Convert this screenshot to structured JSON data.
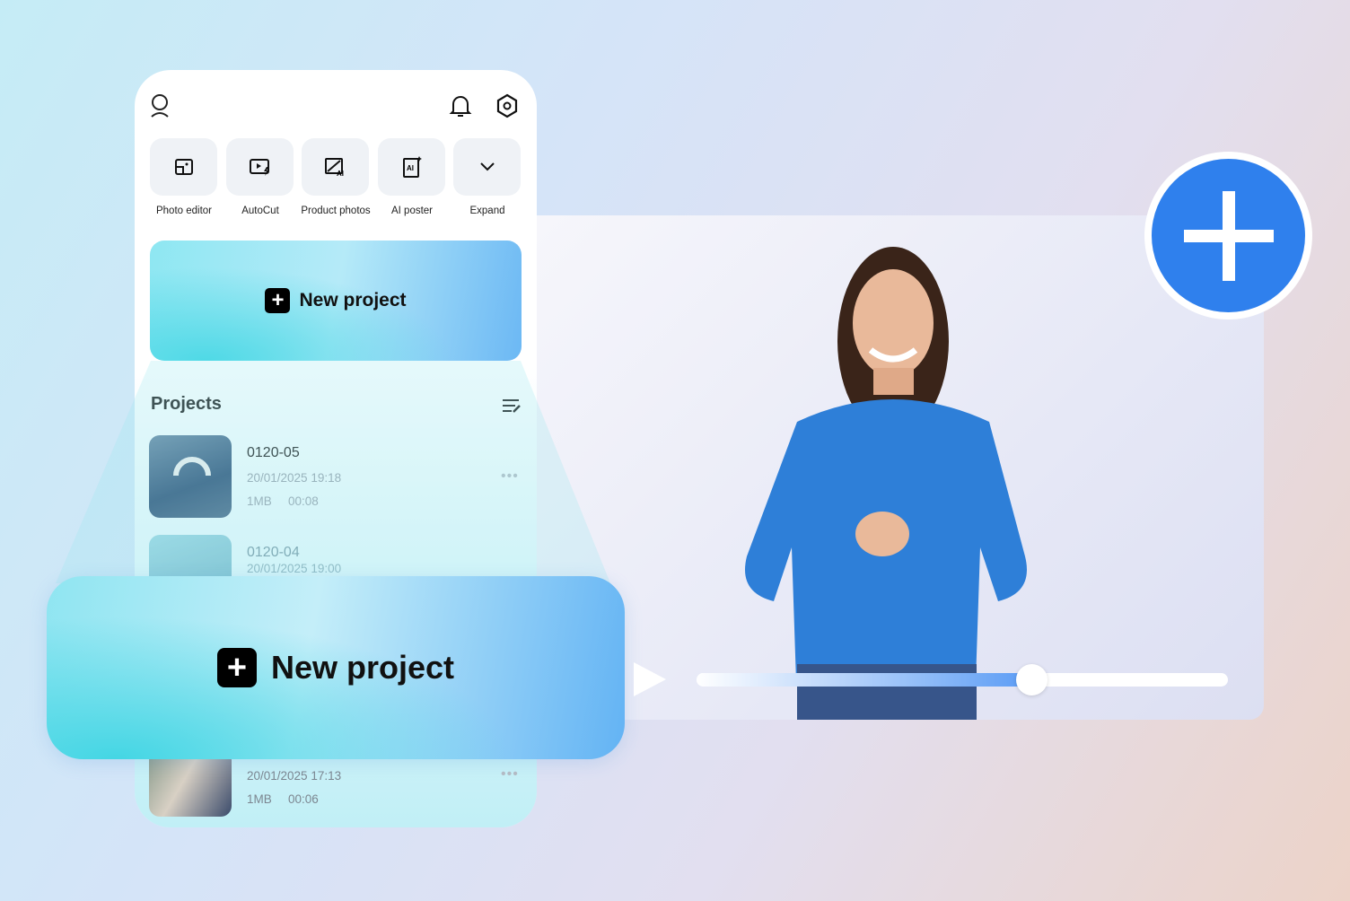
{
  "header": {
    "icons": [
      "user-icon",
      "bell-icon",
      "settings-icon"
    ]
  },
  "tools": [
    {
      "label": "Photo editor",
      "icon": "photo-editor-icon"
    },
    {
      "label": "AutoCut",
      "icon": "autocut-icon"
    },
    {
      "label": "Product photos",
      "icon": "product-photos-icon"
    },
    {
      "label": "AI poster",
      "icon": "ai-poster-icon"
    },
    {
      "label": "Expand",
      "icon": "chevron-down-icon"
    }
  ],
  "new_project_label": "New project",
  "projects_heading": "Projects",
  "projects": [
    {
      "name": "0120-05",
      "date": "20/01/2025 19:18",
      "size": "1MB",
      "duration": "00:08"
    },
    {
      "name": "0120-04",
      "date": "20/01/2025 19:00"
    },
    {
      "date": "20/01/2025 17:13",
      "size": "1MB",
      "duration": "00:06"
    }
  ],
  "player": {
    "progress": 0.63
  },
  "colors": {
    "accent": "#2f80ed",
    "slider_fill": "#5b9cf5"
  }
}
